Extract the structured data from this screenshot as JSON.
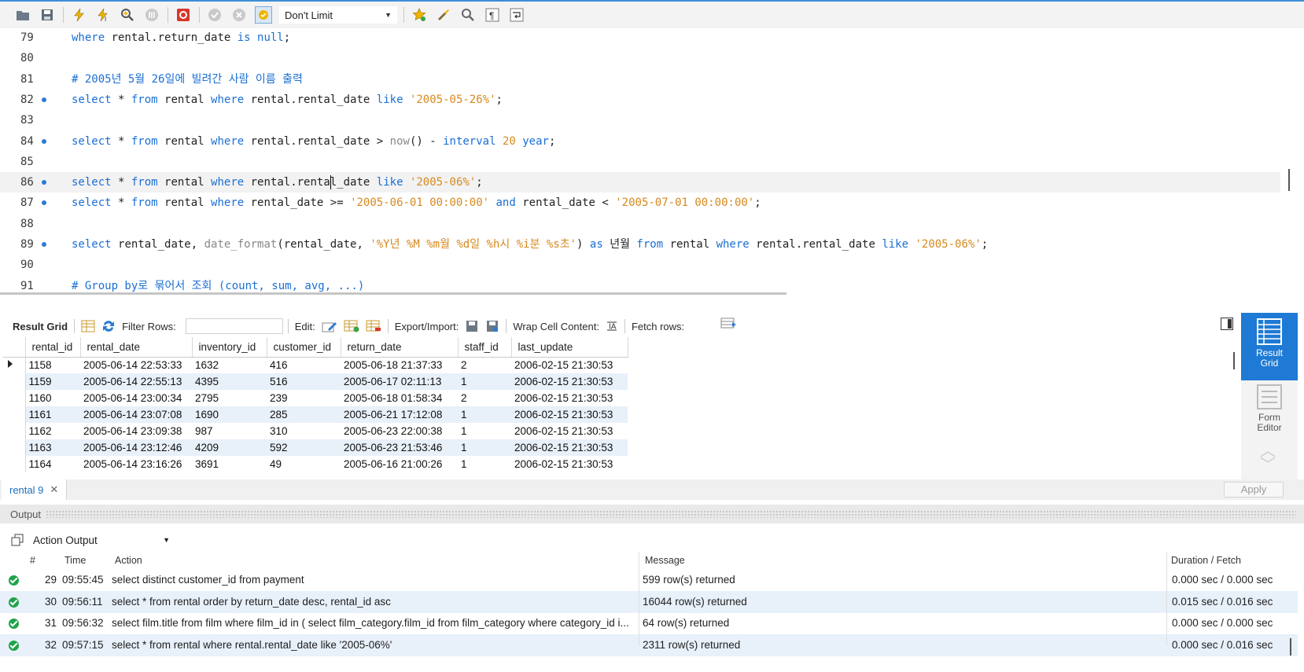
{
  "toolbar": {
    "limit_value": "Don't Limit",
    "icons": [
      "folder-open-icon",
      "save-icon",
      "execute-icon",
      "execute-current-icon",
      "explain-icon",
      "stop-icon",
      "toggle-error-icon",
      "commit-icon",
      "rollback-icon",
      "autocommit-icon",
      "bookmark-icon",
      "beautify-icon",
      "find-icon",
      "invisible-chars-icon",
      "wrap-icon"
    ]
  },
  "editor": {
    "lines": [
      {
        "num": "79",
        "dot": false,
        "tokens": [
          [
            "kw",
            "where "
          ],
          [
            "id",
            "rental.return_date "
          ],
          [
            "kw",
            "is null"
          ],
          [
            "id",
            ";"
          ]
        ]
      },
      {
        "num": "80",
        "dot": false,
        "tokens": []
      },
      {
        "num": "81",
        "dot": false,
        "tokens": [
          [
            "cm",
            "# 2005년 5월 26일에 빌려간 사람 이름 출력"
          ]
        ]
      },
      {
        "num": "82",
        "dot": true,
        "tokens": [
          [
            "kw",
            "select "
          ],
          [
            "id",
            "* "
          ],
          [
            "kw",
            "from "
          ],
          [
            "id",
            "rental "
          ],
          [
            "kw",
            "where "
          ],
          [
            "id",
            "rental.rental_date "
          ],
          [
            "kw",
            "like "
          ],
          [
            "str",
            "'2005-05-26%'"
          ],
          [
            "id",
            ";"
          ]
        ]
      },
      {
        "num": "83",
        "dot": false,
        "tokens": []
      },
      {
        "num": "84",
        "dot": true,
        "tokens": [
          [
            "kw",
            "select "
          ],
          [
            "id",
            "* "
          ],
          [
            "kw",
            "from "
          ],
          [
            "id",
            "rental "
          ],
          [
            "kw",
            "where "
          ],
          [
            "id",
            "rental.rental_date > "
          ],
          [
            "fn",
            "now"
          ],
          [
            "id",
            "() - "
          ],
          [
            "kw",
            "interval "
          ],
          [
            "num",
            "20 "
          ],
          [
            "kw",
            "year"
          ],
          [
            "id",
            ";"
          ]
        ]
      },
      {
        "num": "85",
        "dot": false,
        "tokens": []
      },
      {
        "num": "86",
        "dot": true,
        "current": true,
        "tokens": [
          [
            "kw",
            "select "
          ],
          [
            "id",
            "* "
          ],
          [
            "kw",
            "from "
          ],
          [
            "id",
            "rental "
          ],
          [
            "kw",
            "where "
          ],
          [
            "id",
            "rental.rental_date "
          ],
          [
            "kw",
            "like "
          ],
          [
            "str",
            "'2005-06%'"
          ],
          [
            "id",
            ";"
          ]
        ]
      },
      {
        "num": "87",
        "dot": true,
        "tokens": [
          [
            "kw",
            "select "
          ],
          [
            "id",
            "* "
          ],
          [
            "kw",
            "from "
          ],
          [
            "id",
            "rental "
          ],
          [
            "kw",
            "where "
          ],
          [
            "id",
            "rental_date >= "
          ],
          [
            "str",
            "'2005-06-01 00:00:00' "
          ],
          [
            "kw",
            "and "
          ],
          [
            "id",
            "rental_date < "
          ],
          [
            "str",
            "'2005-07-01 00:00:00'"
          ],
          [
            "id",
            ";"
          ]
        ]
      },
      {
        "num": "88",
        "dot": false,
        "tokens": []
      },
      {
        "num": "89",
        "dot": true,
        "tokens": [
          [
            "kw",
            "select "
          ],
          [
            "id",
            "rental_date, "
          ],
          [
            "fn",
            "date_format"
          ],
          [
            "id",
            "(rental_date, "
          ],
          [
            "str",
            "'%Y년 %M %m월 %d일 %h시 %i분 %s초'"
          ],
          [
            "id",
            ") "
          ],
          [
            "kw",
            "as "
          ],
          [
            "id",
            "년월 "
          ],
          [
            "kw",
            "from "
          ],
          [
            "id",
            "rental "
          ],
          [
            "kw",
            "where "
          ],
          [
            "id",
            "rental.rental_date "
          ],
          [
            "kw",
            "like "
          ],
          [
            "str",
            "'2005-06%'"
          ],
          [
            "id",
            ";"
          ]
        ]
      },
      {
        "num": "90",
        "dot": false,
        "tokens": []
      },
      {
        "num": "91",
        "dot": false,
        "tokens": [
          [
            "cm",
            "# Group by로 묶어서 조회 (count, sum, avg, ...)"
          ]
        ]
      }
    ]
  },
  "grid_toolbar": {
    "result_grid_label": "Result Grid",
    "filter_rows_label": "Filter Rows:",
    "edit_label": "Edit:",
    "export_import_label": "Export/Import:",
    "wrap_label": "Wrap Cell Content:",
    "fetch_label": "Fetch rows:"
  },
  "grid": {
    "columns": [
      "rental_id",
      "rental_date",
      "inventory_id",
      "customer_id",
      "return_date",
      "staff_id",
      "last_update"
    ],
    "rows": [
      [
        "1158",
        "2005-06-14 22:53:33",
        "1632",
        "416",
        "2005-06-18 21:37:33",
        "2",
        "2006-02-15 21:30:53"
      ],
      [
        "1159",
        "2005-06-14 22:55:13",
        "4395",
        "516",
        "2005-06-17 02:11:13",
        "1",
        "2006-02-15 21:30:53"
      ],
      [
        "1160",
        "2005-06-14 23:00:34",
        "2795",
        "239",
        "2005-06-18 01:58:34",
        "2",
        "2006-02-15 21:30:53"
      ],
      [
        "1161",
        "2005-06-14 23:07:08",
        "1690",
        "285",
        "2005-06-21 17:12:08",
        "1",
        "2006-02-15 21:30:53"
      ],
      [
        "1162",
        "2005-06-14 23:09:38",
        "987",
        "310",
        "2005-06-23 22:00:38",
        "1",
        "2006-02-15 21:30:53"
      ],
      [
        "1163",
        "2005-06-14 23:12:46",
        "4209",
        "592",
        "2005-06-23 21:53:46",
        "1",
        "2006-02-15 21:30:53"
      ],
      [
        "1164",
        "2005-06-14 23:16:26",
        "3691",
        "49",
        "2005-06-16 21:00:26",
        "1",
        "2006-02-15 21:30:53"
      ]
    ]
  },
  "side_panel": {
    "result_grid_l1": "Result",
    "result_grid_l2": "Grid",
    "form_editor_l1": "Form",
    "form_editor_l2": "Editor"
  },
  "result_tab": {
    "label": "rental 9",
    "close": "✕"
  },
  "apply_label": "Apply",
  "output": {
    "title": "Output",
    "selector_value": "Action Output",
    "headers": {
      "num": "#",
      "time": "Time",
      "action": "Action",
      "message": "Message",
      "duration": "Duration / Fetch"
    },
    "rows": [
      {
        "num": "29",
        "time": "09:55:45",
        "action": "select distinct customer_id from payment",
        "message": "599 row(s) returned",
        "duration": "0.000 sec / 0.000 sec"
      },
      {
        "num": "30",
        "time": "09:56:11",
        "action": "select * from rental order by return_date desc, rental_id asc",
        "message": "16044 row(s) returned",
        "duration": "0.015 sec / 0.016 sec"
      },
      {
        "num": "31",
        "time": "09:56:32",
        "action": "select film.title from film where film_id in ( select film_category.film_id     from film_category     where category_id i...",
        "message": "64 row(s) returned",
        "duration": "0.000 sec / 0.000 sec"
      },
      {
        "num": "32",
        "time": "09:57:15",
        "action": "select * from rental where rental.rental_date like '2005-06%'",
        "message": "2311 row(s) returned",
        "duration": "0.000 sec / 0.016 sec"
      }
    ]
  }
}
